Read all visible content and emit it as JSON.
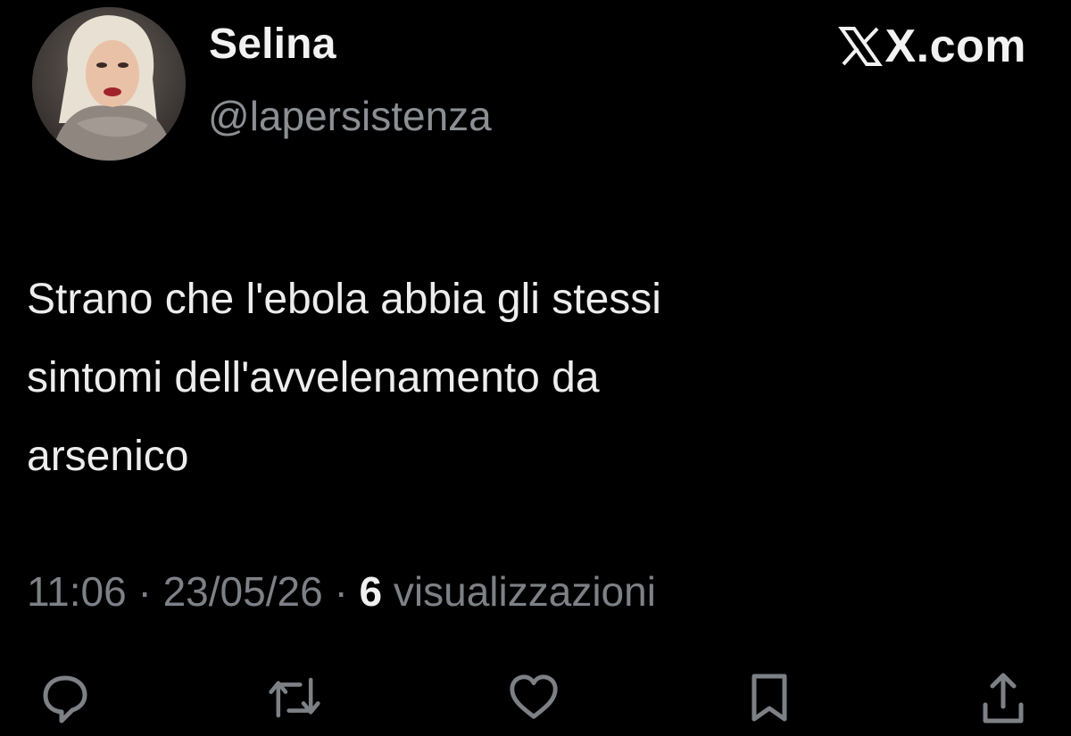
{
  "tweet": {
    "display_name": "Selina",
    "handle": "@lapersistenza",
    "site": "X.com",
    "text_lines": [
      "Strano che l'ebola abbia gli stessi",
      "sintomi dell'avvelenamento da",
      "arsenico"
    ],
    "time": "11:06",
    "separator": "·",
    "date": "23/05/26",
    "views_count": "6",
    "views_label": "visualizzazioni"
  },
  "icons": {
    "avatar": "profile-photo",
    "site_logo": "x-logo-icon",
    "actions": [
      "reply-icon",
      "retweet-icon",
      "like-icon",
      "bookmark-icon",
      "share-icon"
    ]
  },
  "colors": {
    "background": "#000000",
    "primary_text": "#e7e9ea",
    "secondary_text": "#7d8186"
  }
}
